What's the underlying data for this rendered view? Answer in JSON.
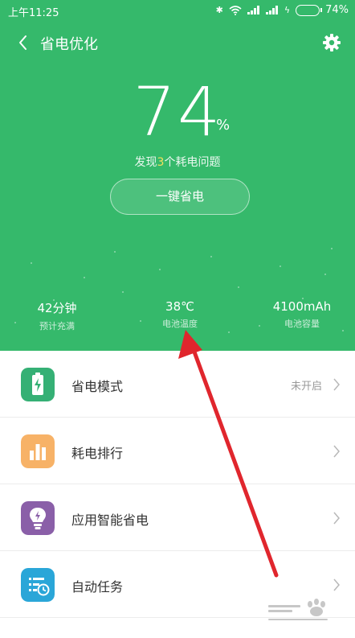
{
  "status_bar": {
    "time": "上午11:25",
    "battery_percent": "74%",
    "battery_level": 0.74,
    "icons": [
      "bluetooth-icon",
      "wifi-icon",
      "signal-icon",
      "signal-icon",
      "charging-icon",
      "battery-icon"
    ]
  },
  "header": {
    "title": "省电优化",
    "back_icon": "chevron-left-icon",
    "settings_icon": "gear-icon"
  },
  "battery": {
    "level": "74",
    "unit": "%",
    "issues_prefix": "发现",
    "issues_count": "3",
    "issues_suffix": "个耗电问题",
    "action_label": "一键省电"
  },
  "stats": [
    {
      "value": "42分钟",
      "label": "预计充满"
    },
    {
      "value": "38℃",
      "label": "电池温度"
    },
    {
      "value": "4100mAh",
      "label": "电池容量"
    }
  ],
  "menu": [
    {
      "label": "省电模式",
      "status": "未开启",
      "icon": "battery-mode-icon",
      "color": "#35b075"
    },
    {
      "label": "耗电排行",
      "status": "",
      "icon": "bar-chart-icon",
      "color": "#f7b267"
    },
    {
      "label": "应用智能省电",
      "status": "",
      "icon": "bulb-icon",
      "color": "#8a5fa8"
    },
    {
      "label": "自动任务",
      "status": "",
      "icon": "task-clock-icon",
      "color": "#2aa6d8"
    }
  ],
  "colors": {
    "hero_green": "#35b96b",
    "highlight_yellow": "#f3e15c",
    "annotation_red": "#e0262d"
  }
}
